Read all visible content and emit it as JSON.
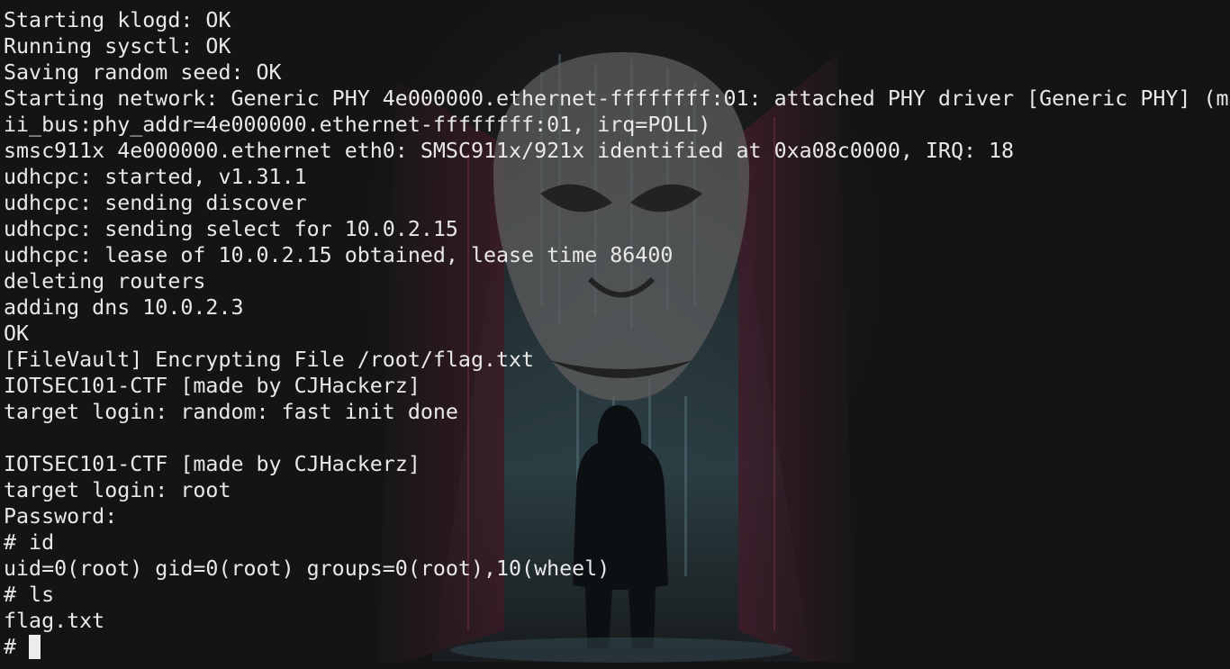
{
  "terminal": {
    "lines": [
      "Starting klogd: OK",
      "Running sysctl: OK",
      "Saving random seed: OK",
      "Starting network: Generic PHY 4e000000.ethernet-ffffffff:01: attached PHY driver [Generic PHY] (m",
      "ii_bus:phy_addr=4e000000.ethernet-ffffffff:01, irq=POLL)",
      "smsc911x 4e000000.ethernet eth0: SMSC911x/921x identified at 0xa08c0000, IRQ: 18",
      "udhcpc: started, v1.31.1",
      "udhcpc: sending discover",
      "udhcpc: sending select for 10.0.2.15",
      "udhcpc: lease of 10.0.2.15 obtained, lease time 86400",
      "deleting routers",
      "adding dns 10.0.2.3",
      "OK",
      "[FileVault] Encrypting File /root/flag.txt",
      "IOTSEC101-CTF [made by CJHackerz]",
      "target login: random: fast init done",
      "",
      "IOTSEC101-CTF [made by CJHackerz]",
      "target login: root",
      "Password:",
      "# id",
      "uid=0(root) gid=0(root) groups=0(root),10(wheel)",
      "# ls",
      "flag.txt"
    ],
    "prompt": "# ",
    "colors": {
      "background": "#141414",
      "foreground": "#e8e8e8",
      "cursor": "#ececec"
    }
  }
}
